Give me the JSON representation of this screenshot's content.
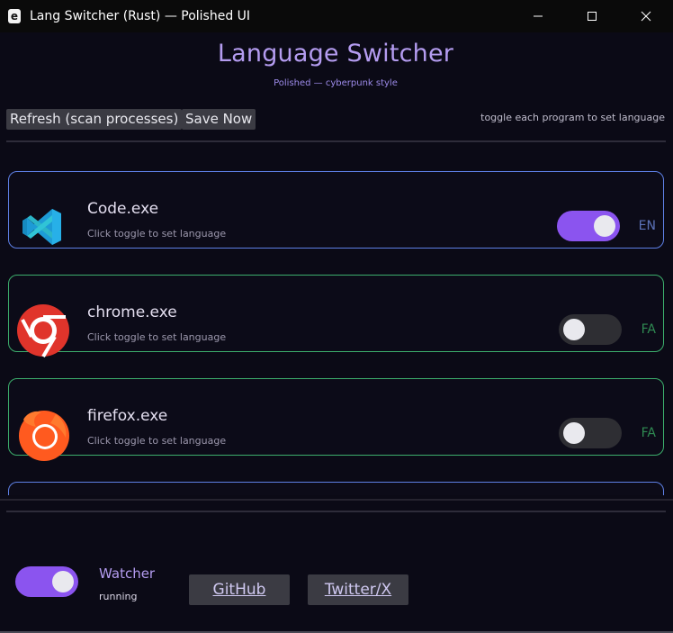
{
  "window": {
    "title": "Lang Switcher (Rust) — Polished UI",
    "app_icon_letter": "e"
  },
  "header": {
    "title": "Language Switcher",
    "subtitle": "Polished — cyberpunk style"
  },
  "toolbar": {
    "refresh_label": "Refresh (scan processes)",
    "save_label": "Save Now",
    "hint": "toggle each program to set language"
  },
  "programs": [
    {
      "name": "Code.exe",
      "subtitle": "Click toggle to set language",
      "lang": "EN",
      "enabled": true,
      "border_color": "#5e80e6",
      "icon": "vscode-icon"
    },
    {
      "name": "chrome.exe",
      "subtitle": "Click toggle to set language",
      "lang": "FA",
      "enabled": false,
      "border_color": "#3cae6c",
      "icon": "chrome-icon"
    },
    {
      "name": "firefox.exe",
      "subtitle": "Click toggle to set language",
      "lang": "FA",
      "enabled": false,
      "border_color": "#3cae6c",
      "icon": "firefox-icon"
    }
  ],
  "footer": {
    "watcher_label": "Watcher",
    "watcher_status": "running",
    "watcher_enabled": true,
    "github_label": "GitHub",
    "twitter_label": "Twitter/X"
  },
  "colors": {
    "accent": "#8b54ef",
    "title": "#b49cf0",
    "en": "#5b72b8",
    "fa": "#2f8a52",
    "background": "#0b0a16"
  }
}
